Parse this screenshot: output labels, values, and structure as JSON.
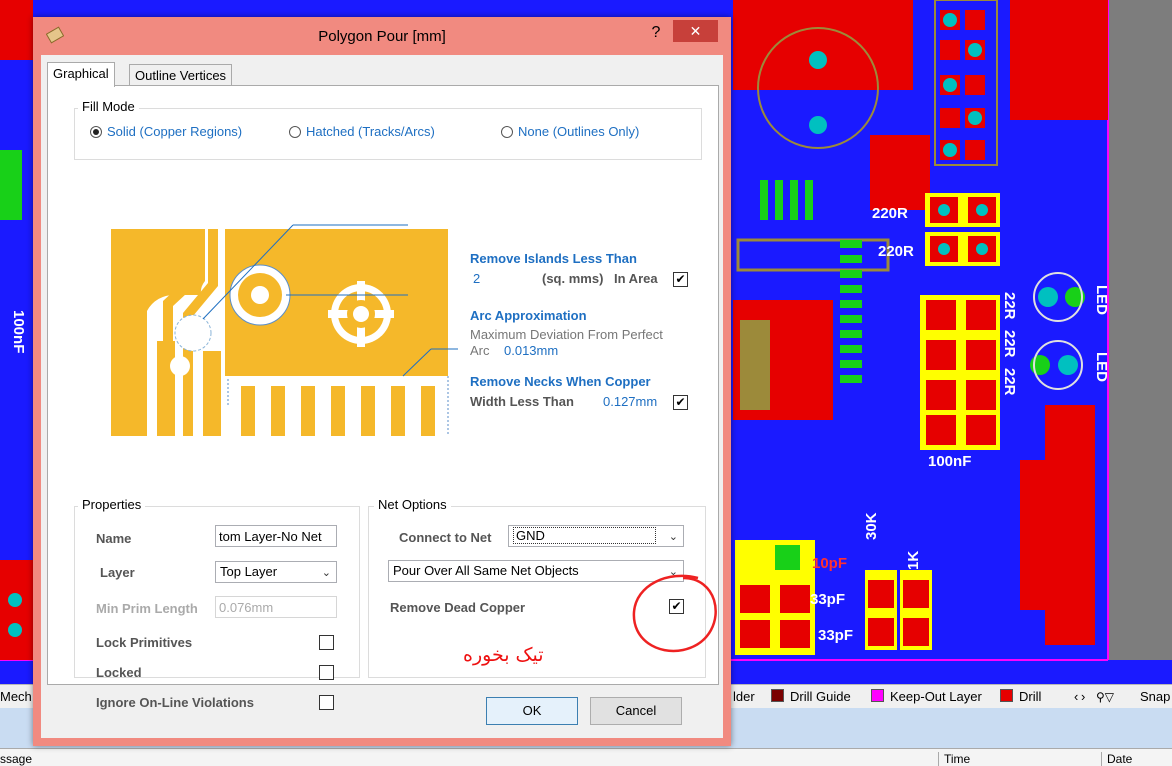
{
  "dialog": {
    "title": "Polygon Pour [mm]",
    "help": "?",
    "close": "✕",
    "tabs": [
      "Graphical",
      "Outline Vertices"
    ]
  },
  "fill_mode": {
    "title": "Fill Mode",
    "options": [
      "Solid (Copper Regions)",
      "Hatched (Tracks/Arcs)",
      "None (Outlines Only)"
    ],
    "selected": 0
  },
  "islands": {
    "title": "Remove Islands Less Than",
    "value": "2",
    "unit": "(sq. mms)",
    "suffix": "In Area",
    "checked": "✔"
  },
  "arc": {
    "title": "Arc Approximation",
    "line1": "Maximum Deviation From Perfect",
    "line2": "Arc",
    "value": "0.013mm"
  },
  "necks": {
    "title": "Remove Necks When Copper",
    "line2": "Width Less Than",
    "value": "0.127mm",
    "checked": "✔"
  },
  "properties": {
    "title": "Properties",
    "name_label": "Name",
    "name_value": "tom Layer-No Net",
    "layer_label": "Layer",
    "layer_value": "Top Layer",
    "minprim_label": "Min Prim Length",
    "minprim_value": "0.076mm",
    "lock_primitives": "Lock Primitives",
    "locked": "Locked",
    "ignore_violations": "Ignore On-Line Violations"
  },
  "net_options": {
    "title": "Net Options",
    "connect_label": "Connect to Net",
    "connect_value": "GND",
    "pour_value": "Pour Over All Same Net Objects",
    "dead_copper": "Remove Dead Copper",
    "dead_checked": "✔"
  },
  "annotation": "تیک بخوره",
  "buttons": {
    "ok": "OK",
    "cancel": "Cancel"
  },
  "pcb_labels": {
    "r1": "220R",
    "r2": "220R",
    "r3": "22R",
    "r4": "22R",
    "r5": "22R",
    "led1": "LED",
    "led2": "LED",
    "c1": "100nF",
    "c2": "10pF",
    "c3": "33pF",
    "c4": "33pF",
    "r6": "30K",
    "r7": "1K",
    "left1": "100nF"
  },
  "layer_tabs": {
    "left": "Mech",
    "t1": "lder",
    "t2": "Drill Guide",
    "t3": "Keep-Out Layer",
    "t4": "Drill",
    "snap": "Snap"
  },
  "colors": {
    "drill_guide": "#7a0000",
    "keepout": "#ff00ff",
    "drill": "#e60000",
    "board": "#1a1aff",
    "copper": "#e60000"
  },
  "messages": {
    "col1": "ssage",
    "col2": "Time",
    "col3": "Date"
  }
}
